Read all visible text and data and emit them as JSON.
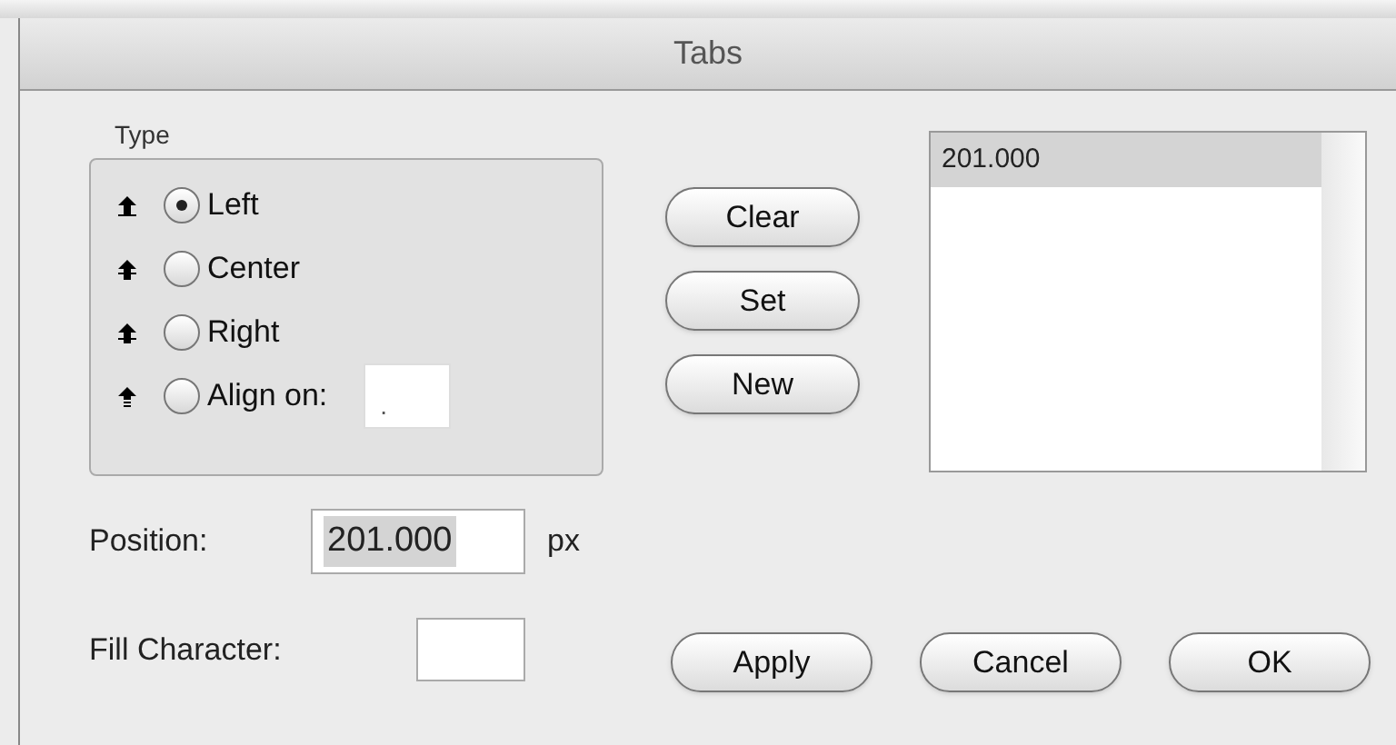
{
  "window": {
    "title": "Tabs"
  },
  "type_group": {
    "label": "Type",
    "options": [
      {
        "kind": "left",
        "label": "Left",
        "selected": true
      },
      {
        "kind": "center",
        "label": "Center",
        "selected": false
      },
      {
        "kind": "right",
        "label": "Right",
        "selected": false
      },
      {
        "kind": "align",
        "label": "Align on:",
        "selected": false,
        "value": "."
      }
    ]
  },
  "side_buttons": [
    "Clear",
    "Set",
    "New"
  ],
  "tab_list": [
    {
      "label": "201.000",
      "selected": true
    }
  ],
  "position": {
    "label": "Position:",
    "value": "201.000",
    "unit": "px"
  },
  "fill_character": {
    "label": "Fill Character:"
  },
  "buttons": [
    "Apply",
    "Cancel",
    "OK"
  ]
}
